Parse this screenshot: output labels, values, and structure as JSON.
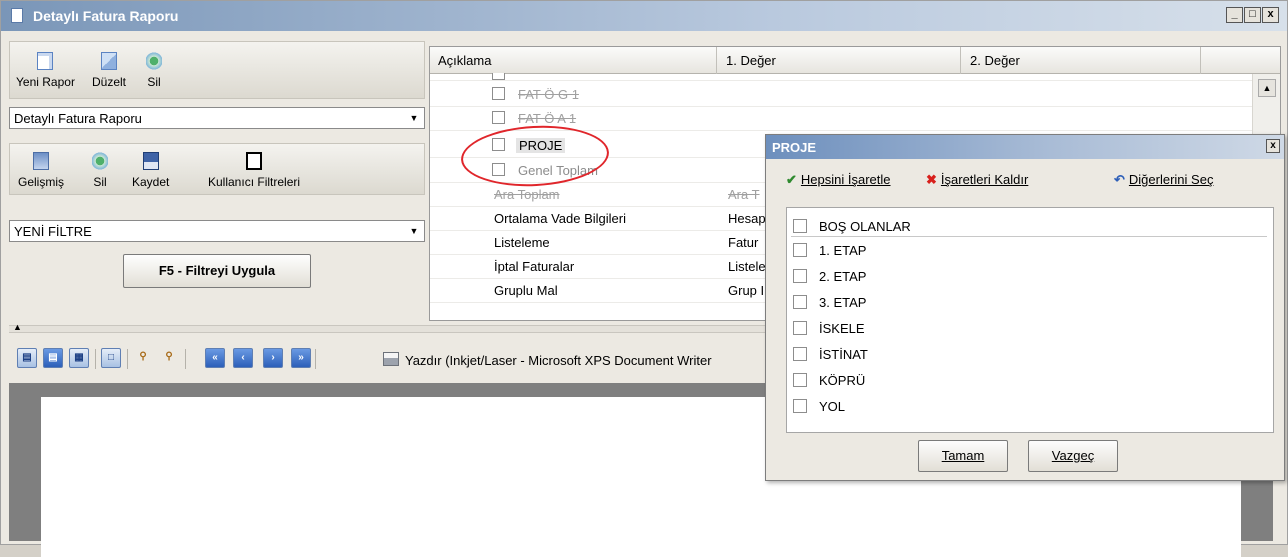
{
  "window": {
    "title": "Detaylı Fatura Raporu",
    "controls": [
      "_",
      "□",
      "x"
    ]
  },
  "report_toolbar": {
    "new_label": "Yeni Rapor",
    "edit_label": "Düzelt",
    "delete_label": "Sil"
  },
  "report_select": {
    "value": "Detaylı Fatura Raporu"
  },
  "filter_toolbar": {
    "advanced_label": "Gelişmiş",
    "delete_label": "Sil",
    "save_label": "Kaydet",
    "user_filters_label": "Kullanıcı Filtreleri"
  },
  "filter_select": {
    "value": "YENİ FİLTRE"
  },
  "apply_button": {
    "label": "F5 - Filtreyi Uygula"
  },
  "grid": {
    "headers": [
      "Açıklama",
      "1. Değer",
      "2. Değer"
    ],
    "rows": [
      {
        "label": "FAT Ö G 1",
        "checkbox": true,
        "struck": true,
        "value1": ""
      },
      {
        "label": "FAT Ö A 1",
        "checkbox": true,
        "struck": true,
        "value1": ""
      },
      {
        "label": "PROJE",
        "checkbox": true,
        "struck": false,
        "value1": ""
      },
      {
        "label": "Genel Toplam",
        "checkbox": true,
        "struck": false,
        "value1": ""
      },
      {
        "label": "Ara Toplam",
        "checkbox": false,
        "struck": true,
        "value1": "Ara T"
      },
      {
        "label": "Ortalama Vade Bilgileri",
        "checkbox": false,
        "struck": false,
        "value1": "Hesap"
      },
      {
        "label": "Listeleme",
        "checkbox": false,
        "struck": false,
        "value1": "Fatur"
      },
      {
        "label": "İptal Faturalar",
        "checkbox": false,
        "struck": false,
        "value1": "Listele"
      },
      {
        "label": "Gruplu Mal",
        "checkbox": false,
        "struck": false,
        "value1": "Grup I"
      }
    ]
  },
  "preview_toolbar": {
    "print_label": "Yazdır (Inkjet/Laser - Microsoft XPS Document Writer"
  },
  "dialog": {
    "title": "PROJE",
    "select_all_label": "Hepsini İşaretle",
    "clear_label": "İşaretleri Kaldır",
    "invert_label": "Diğerlerini Seç",
    "items": [
      "BOŞ OLANLAR",
      "1. ETAP",
      "2. ETAP",
      "3. ETAP",
      "İSKELE",
      "İSTİNAT",
      "KÖPRÜ",
      "YOL"
    ],
    "ok_label": "Tamam",
    "cancel_label": "Vazgeç"
  }
}
